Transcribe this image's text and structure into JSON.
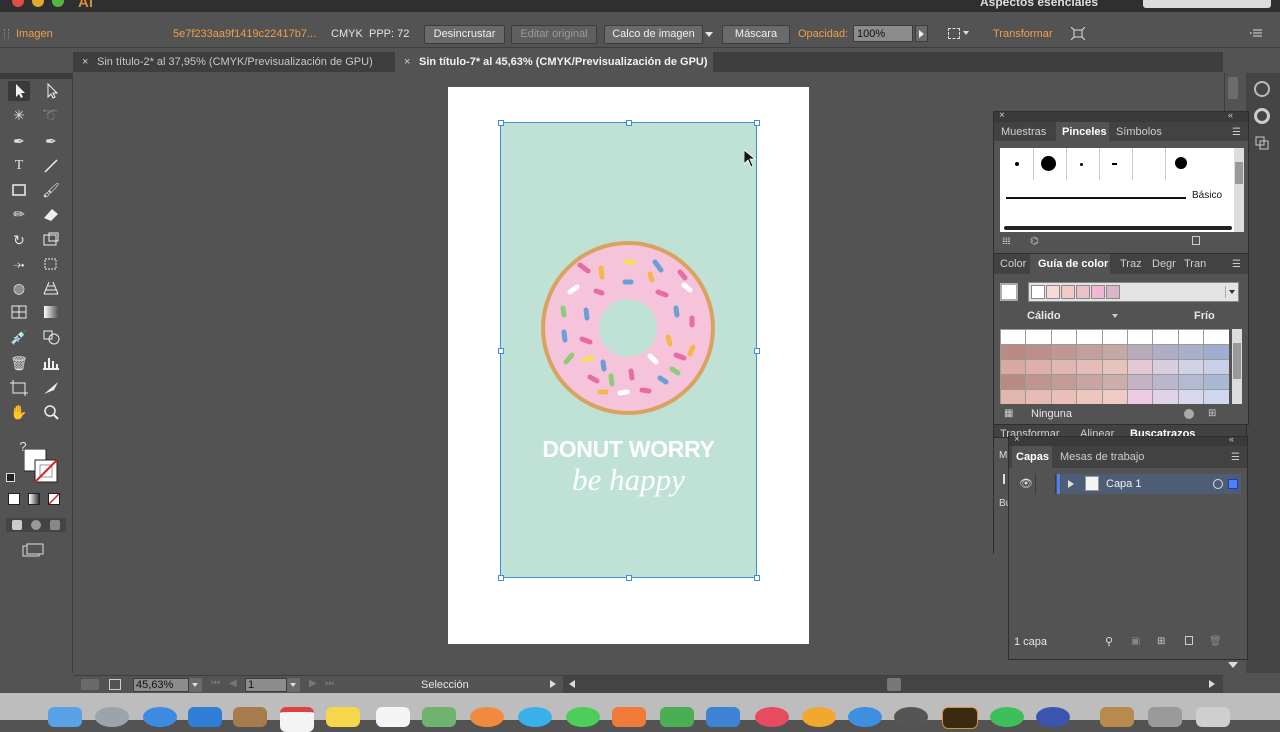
{
  "app": {
    "logo": "Ai",
    "workspace": "Aspectos esenciales"
  },
  "controlbar": {
    "object_type": "Imagen",
    "link_name": "5e7f233aa9f1419c22417b7...",
    "color_mode": "CMYK",
    "ppi": "PPP: 72",
    "embed_button": "Desincrustar",
    "edit_original_button": "Editar original",
    "image_trace_button": "Calco de imagen",
    "mask_button": "Máscara",
    "opacity_label": "Opacidad:",
    "opacity_value": "100%",
    "transform_link": "Transformar"
  },
  "tabs": [
    {
      "label": "Sin título-2* al 37,95% (CMYK/Previsualización de GPU)",
      "active": false
    },
    {
      "label": "Sin título-7* al 45,63% (CMYK/Previsualización de GPU)",
      "active": true
    }
  ],
  "tools": {
    "help_glyph": "?"
  },
  "poster": {
    "headline": "DONUT WORRY",
    "tagline": "be happy",
    "background_color": "#bfe1d6",
    "dough_color": "#d9a25f",
    "icing_color": "#f5c4da"
  },
  "brushes_panel": {
    "tabs": [
      "Muestras",
      "Pinceles",
      "Símbolos"
    ],
    "active_tab": "Pinceles",
    "basic_label": "Básico"
  },
  "color_guide_panel": {
    "tabs": [
      "Color",
      "Guía de color",
      "Traz",
      "Degr",
      "Tran"
    ],
    "active_tab": "Guía de color",
    "warm_label": "Cálido",
    "cool_label": "Frío",
    "harmony_label": "Ninguna",
    "harmony_swatches": [
      "#ffffff",
      "#f7d9d5",
      "#f3c9c5",
      "#eac0c9",
      "#f2b7d5",
      "#d9b5c9"
    ],
    "grid_columns": [
      [
        "#ffffff",
        "#b98a82",
        "#d9aaa2",
        "#b98a82",
        "#e1b7ad"
      ],
      [
        "#ffffff",
        "#bc9089",
        "#ddb0a8",
        "#c0958e",
        "#e6bbb2"
      ],
      [
        "#ffffff",
        "#c09892",
        "#e0b8b0",
        "#c59c95",
        "#e9c0b8"
      ],
      [
        "#ffffff",
        "#c3a09b",
        "#e3bdb6",
        "#c8a5a0",
        "#edc6bf"
      ],
      [
        "#ffffff",
        "#c6a8a4",
        "#e7c3bd",
        "#cdaeab",
        "#f0cbc6"
      ],
      [
        "#ffffff",
        "#b8aab9",
        "#e4c8d6",
        "#c3b2c3",
        "#eccbe0"
      ],
      [
        "#ffffff",
        "#b0aec6",
        "#d9cde0",
        "#bbb6cc",
        "#e0d2e8"
      ],
      [
        "#ffffff",
        "#a8b0cc",
        "#d0d2e6",
        "#b3bad2",
        "#d7d8ec"
      ],
      [
        "#ffffff",
        "#9faed0",
        "#c8d0e8",
        "#aab8d5",
        "#cfd6ee"
      ]
    ]
  },
  "peek_tabs": [
    "Transformar",
    "Alinear",
    "Buscatrazos"
  ],
  "layers_panel": {
    "tabs": [
      "Capas",
      "Mesas de trabajo"
    ],
    "active_tab": "Capas",
    "layer_name": "Capa 1",
    "layer_count": "1 capa",
    "layer_color": "#4e7fff"
  },
  "statusbar": {
    "zoom": "45,63%",
    "artboard_number": "1",
    "current_tool": "Selección"
  }
}
